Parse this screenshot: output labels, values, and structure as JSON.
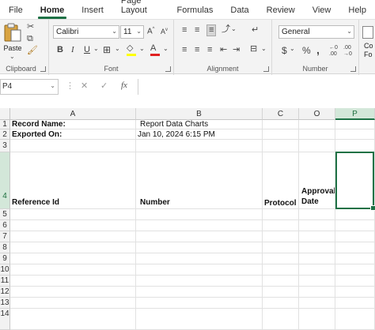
{
  "menu": {
    "tabs": [
      "File",
      "Home",
      "Insert",
      "Page Layout",
      "Formulas",
      "Data",
      "Review",
      "View",
      "Help"
    ]
  },
  "ribbon": {
    "clipboard": {
      "paste_label": "Paste",
      "group_label": "Clipboard"
    },
    "font": {
      "font_name": "Calibri",
      "font_size": "11",
      "group_label": "Font"
    },
    "alignment": {
      "group_label": "Alignment"
    },
    "number": {
      "format": "General",
      "group_label": "Number"
    },
    "cut_off_label": "Co\nFo"
  },
  "formula_bar": {
    "name_box": "P4",
    "cancel": "✕",
    "enter": "✓",
    "function": "fx",
    "value": ""
  },
  "sheet": {
    "columns": [
      "A",
      "B",
      "C",
      "O",
      "P"
    ],
    "active_column": "P",
    "active_row": "4",
    "rows": [
      "1",
      "2",
      "3",
      "4",
      "5",
      "6",
      "7",
      "8",
      "9",
      "10",
      "11",
      "12",
      "13",
      "14"
    ],
    "cells": {
      "A1": "Record Name:",
      "B1": "Report Data Charts",
      "A2": "Exported On:",
      "B2": "Jan 10, 2024 6:15 PM",
      "A4": "Reference Id",
      "B4": "Number",
      "C4": "Protocol",
      "O4_line1": "Approval",
      "O4_line2": "Date"
    }
  },
  "colors": {
    "accent": "#1e7145",
    "selected_header_bg": "#d3e7d9"
  }
}
